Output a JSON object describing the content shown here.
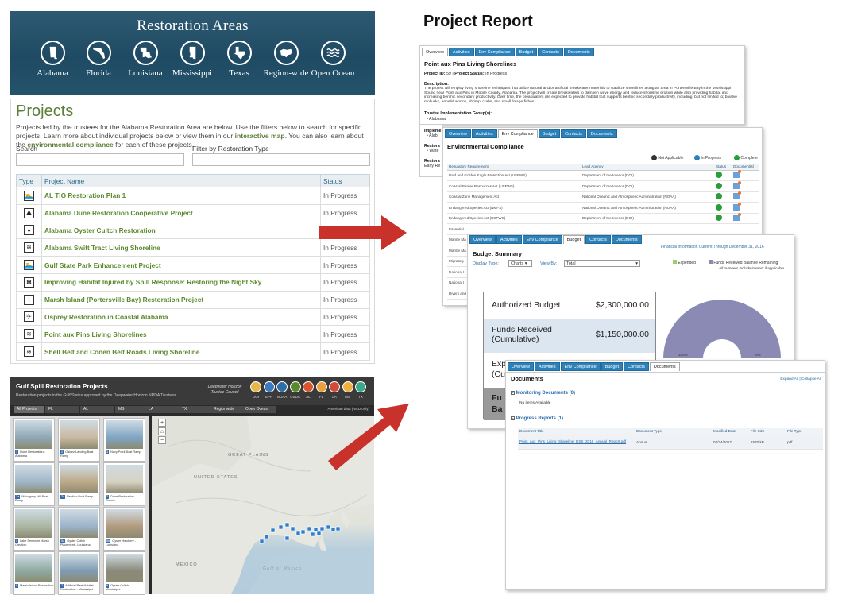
{
  "banner": {
    "title": "Restoration Areas",
    "areas": [
      {
        "label": "Alabama",
        "icon": "alabama-state-icon"
      },
      {
        "label": "Florida",
        "icon": "florida-state-icon"
      },
      {
        "label": "Louisiana",
        "icon": "louisiana-state-icon"
      },
      {
        "label": "Mississippi",
        "icon": "mississippi-state-icon"
      },
      {
        "label": "Texas",
        "icon": "texas-state-icon"
      },
      {
        "label": "Region-wide",
        "icon": "region-wide-icon"
      },
      {
        "label": "Open Ocean",
        "icon": "open-ocean-icon"
      }
    ]
  },
  "projects": {
    "title": "Projects",
    "desc_1": "Projects led by the trustees for the Alabama Restoration Area are below. Use the filters below to search for specific projects. Learn more about individual projects below or view them in our ",
    "desc_link1": "interactive map",
    "desc_2": ". You can also learn about the ",
    "desc_link2": "environmental compliance",
    "desc_3": " for each of these projects.",
    "search_label": "Search",
    "filter_label": "Filter by Restoration Type",
    "columns": {
      "type": "Type",
      "name": "Project Name",
      "status": "Status"
    },
    "rows": [
      {
        "name": "AL TIG Restoration Plan 1",
        "status": "In Progress",
        "icon": "swimmer-icon"
      },
      {
        "name": "Alabama Dune Restoration Cooperative Project",
        "status": "In Progress",
        "icon": "dune-icon"
      },
      {
        "name": "Alabama Oyster Cultch Restoration",
        "status": "",
        "icon": "oyster-icon"
      },
      {
        "name": "Alabama Swift Tract Living Shoreline",
        "status": "In Progress",
        "icon": "shoreline-icon"
      },
      {
        "name": "Gulf State Park Enhancement Project",
        "status": "In Progress",
        "icon": "swimmer-icon"
      },
      {
        "name": "Improving Habitat Injured by Spill Response: Restoring the Night Sky",
        "status": "In Progress",
        "icon": "turtle-icon"
      },
      {
        "name": "Marsh Island (Portersville Bay) Restoration Project",
        "status": "In Progress",
        "icon": "marsh-icon"
      },
      {
        "name": "Osprey Restoration in Coastal Alabama",
        "status": "In Progress",
        "icon": "bird-icon"
      },
      {
        "name": "Point aux Pins Living Shorelines",
        "status": "In Progress",
        "icon": "shoreline-icon"
      },
      {
        "name": "Shell Belt and Coden Belt Roads Living Shoreline",
        "status": "In Progress",
        "icon": "shoreline-icon"
      }
    ]
  },
  "map": {
    "title": "Gulf Spill Restoration Projects",
    "subtitle": "Restoration projects in the Gulf States approved by the Deepwater Horizon NRDA Trustees",
    "council": "Deepwater Horizon Trustee Council",
    "logos": [
      "DOI",
      "EPA",
      "NOAA",
      "USDA",
      "AL",
      "FL",
      "LA",
      "MS",
      "TX"
    ],
    "tabs": [
      "All Projects",
      "FL",
      "AL",
      "MS",
      "LA",
      "TX",
      "Regionwide",
      "Open Ocean"
    ],
    "thumbs": [
      {
        "num": "1",
        "cap": "Dune Restoration - Alabama"
      },
      {
        "num": "2",
        "cap": "Galvez Landing Boat Ramp"
      },
      {
        "num": "3",
        "cap": "Navy Point Boat Ramp"
      },
      {
        "num": "2a",
        "cap": "Mahogany Mill Boat Ramp"
      },
      {
        "num": "2d",
        "cap": "Perdido Boat Ramp"
      },
      {
        "num": "2",
        "cap": "Dune Restoration - Florida"
      },
      {
        "num": "4",
        "cap": "Lake Seminole Marsh Creation"
      },
      {
        "num": "5a",
        "cap": "Oyster Cultch Placement - Louisiana"
      },
      {
        "num": "5b",
        "cap": "Oyster Hatchery - Louisiana"
      },
      {
        "num": "6",
        "cap": "Marsh Island Restoration"
      },
      {
        "num": "7",
        "cap": "Artificial Reef Habitat Restoration - Mississippi"
      },
      {
        "num": "8",
        "cap": "Oyster Cultch - Mississippi"
      }
    ],
    "zoom_in": "+",
    "home": "⌂",
    "zoom_out": "−",
    "basemap": "American data (NRD only)",
    "labels": [
      "UNITED STATES",
      "GREAT PLAINS",
      "MÉXICO",
      "Gulf of Mexico"
    ]
  },
  "report": {
    "title": "Project Report",
    "overview": {
      "tabs": [
        "Overview",
        "Activities",
        "Env Compliance",
        "Budget",
        "Contacts",
        "Documents"
      ],
      "project": "Point aux Pins Living Shorelines",
      "project_id_label": "Project ID:",
      "project_id": "59",
      "status_label": "Project Status:",
      "status": "In Progress",
      "desc_label": "Description:",
      "desc": "The project will employ living shoreline techniques that utilize natural and/or artificial breakwater materials to stabilize shorelines along an area in Portersville Bay in the Mississippi Sound near Point aux Pins in Mobile County, Alabama. The project will create breakwaters to dampen wave energy and reduce shoreline erosion while also providing habitat and increasing benthic secondary productivity. Over time, the breakwaters are expected to provide habitat that supports benthic secondary productivity, including, but not limited to; bivalve mollusks, annelid worms, shrimp, crabs, and small forage fishes.",
      "tig_label": "Trustee Implementation Group(s):",
      "tig": "Alabama",
      "impl_label": "Impleme",
      "impl_val": "Alab",
      "rest_label": "Restora",
      "rest_val": "Wate",
      "rest2_label": "Restora",
      "rest2_val": "Early Re"
    },
    "env": {
      "tabs": [
        "Overview",
        "Activities",
        "Env Compliance",
        "Budget",
        "Contacts",
        "Documents"
      ],
      "title": "Environmental Compliance",
      "legend": [
        "Not Applicable",
        "In Progress",
        "Complete"
      ],
      "columns": [
        "Regulatory Requirement",
        "Lead Agency",
        "Status",
        "Document(s)"
      ],
      "rows": [
        {
          "req": "Bald and Golden Eagle Protection Act (USFWS)",
          "agency": "Department of the Interior (DOI)"
        },
        {
          "req": "Coastal Barrier Resources Act (USFWS)",
          "agency": "Department of the Interior (DOI)"
        },
        {
          "req": "Coastal Zone Management Act",
          "agency": "National Oceanic and Atmospheric Administration (NOAA)"
        },
        {
          "req": "Endangered Species Act (NMFS)",
          "agency": "National Oceanic and Atmospheric Administration (NOAA)"
        },
        {
          "req": "Endangered Species Act (USFWS)",
          "agency": "Department of the Interior (DOI)"
        },
        {
          "req": "Essential",
          "agency": ""
        },
        {
          "req": "Marine Ma",
          "agency": ""
        },
        {
          "req": "Marine Ma",
          "agency": ""
        },
        {
          "req": "Migratory",
          "agency": ""
        },
        {
          "req": "National I",
          "agency": ""
        },
        {
          "req": "National I",
          "agency": ""
        },
        {
          "req": "Rivers and",
          "agency": ""
        }
      ]
    },
    "budget": {
      "tabs": [
        "Overview",
        "Activities",
        "Env Compliance",
        "Budget",
        "Contacts",
        "Documents"
      ],
      "financial_note": "Financial Information Current Through December 31, 2016",
      "title": "Budget Summary",
      "display_label": "Display Type:",
      "display_value": "Charts",
      "view_label": "View By:",
      "view_value": "Total",
      "legend_expended": "Expended",
      "legend_received": "Funds Received Balance Remaining",
      "note": "All numbers include interest if applicable",
      "rows": [
        {
          "label": "Authorized Budget",
          "value": "$2,300,000.00"
        },
        {
          "label": "Funds Received (Cumulative)",
          "value": "$1,150,000.00"
        },
        {
          "label": "Exp (Cu",
          "value": ""
        },
        {
          "label": "Fu Ba",
          "value": ""
        }
      ],
      "pie_labels": [
        "100%",
        "0%"
      ],
      "colors": {
        "received": "#8a8ab5",
        "expended": "#9ccf6b"
      }
    },
    "documents": {
      "tabs": [
        "Overview",
        "Activities",
        "Env Compliance",
        "Budget",
        "Contacts",
        "Documents"
      ],
      "title": "Documents",
      "expand_all": "Expand All",
      "collapse_all": "Collapse All",
      "sep": " | ",
      "monitoring": "Monitoring Documents (0)",
      "no_items": "No items Available",
      "progress": "Progress Reports (1)",
      "columns": [
        "Document Title",
        "Document Type",
        "Modified Date",
        "File Size",
        "File Type"
      ],
      "row": {
        "title": "Point_aux_Pins_Living_Shoreline_DSS_2016_Annual_Report.pdf",
        "type": "Annual",
        "date": "04/24/2017",
        "size": "1570 kB",
        "ftype": "pdf"
      }
    }
  },
  "colors": {
    "accent_green": "#5b8a2e",
    "tab_blue": "#2c82b8",
    "arrow_red": "#c8322b",
    "banner": "#24536b"
  }
}
